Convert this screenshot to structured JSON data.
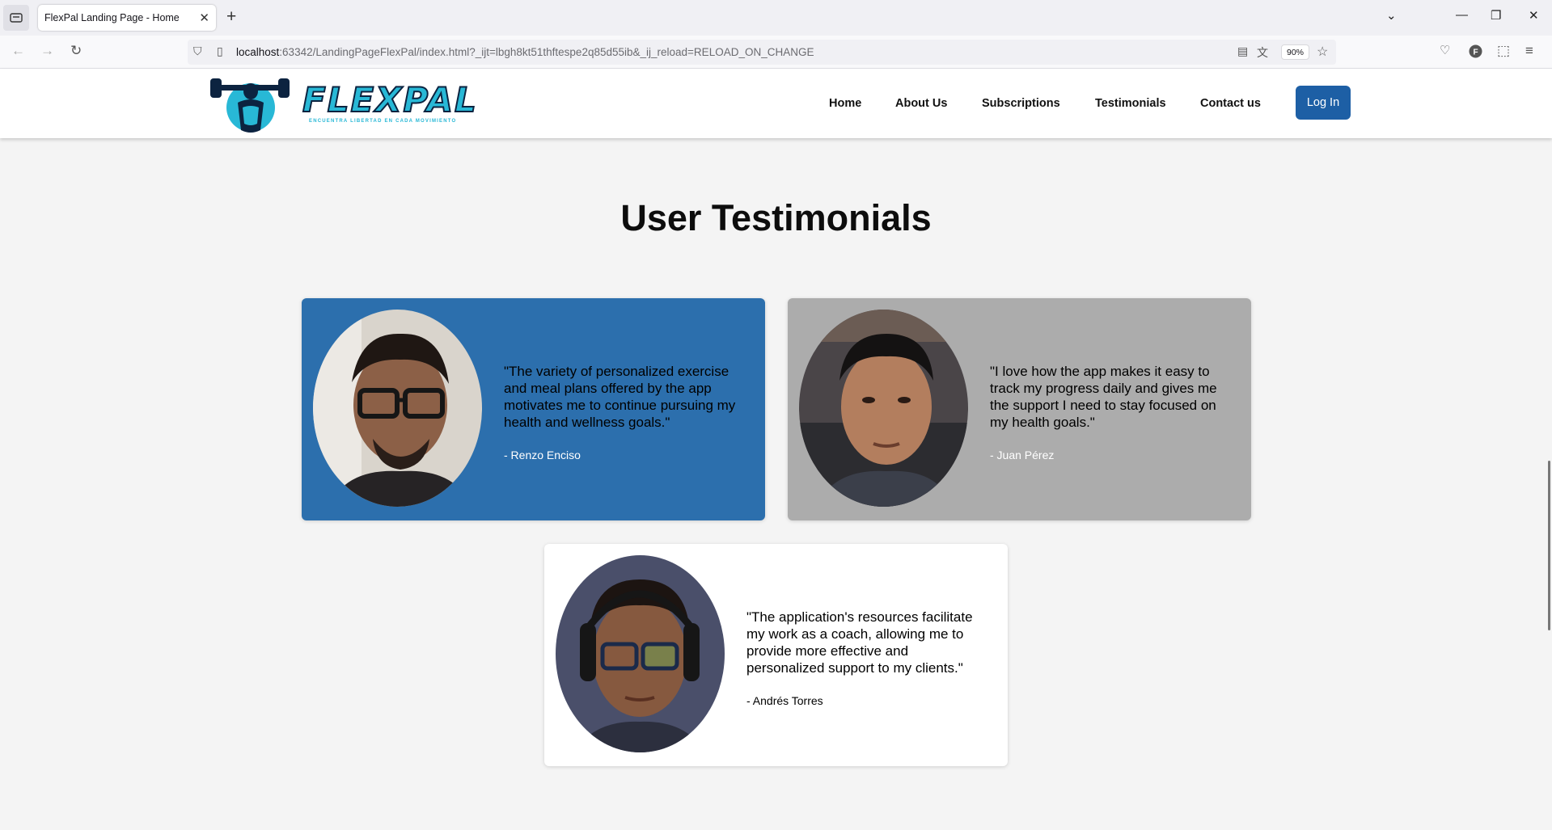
{
  "browser": {
    "tab_title": "FlexPal Landing Page - Home",
    "url_host": "localhost",
    "url_rest": ":63342/LandingPageFlexPal/index.html?_ijt=lbgh8kt51thftespe2q85d55ib&_ij_reload=RELOAD_ON_CHANGE",
    "zoom": "90%"
  },
  "site": {
    "logo_text": "FLEXPAL",
    "logo_tagline": "ENCUENTRA LIBERTAD EN CADA MOVIMIENTO",
    "nav": [
      "Home",
      "About Us",
      "Subscriptions",
      "Testimonials",
      "Contact us"
    ],
    "login_label": "Log In"
  },
  "testimonials": {
    "title": "User Testimonials",
    "items": [
      {
        "quote": "\"The variety of personalized exercise and meal plans offered by the app motivates me to continue pursuing my health and wellness goals.\"",
        "author": "- Renzo Enciso"
      },
      {
        "quote": "\"I love how the app makes it easy to track my progress daily and gives me the support I need to stay focused on my health goals.\"",
        "author": "- Juan Pérez"
      },
      {
        "quote": "\"The application's resources facilitate my work as a coach, allowing me to provide more effective and personalized support to my clients.\"",
        "author": "- Andrés Torres"
      }
    ]
  },
  "colors": {
    "card_blue": "#2c6fad",
    "card_grey": "#acacac",
    "brand_cyan": "#28b8d6",
    "login_blue": "#1d5fa5"
  }
}
